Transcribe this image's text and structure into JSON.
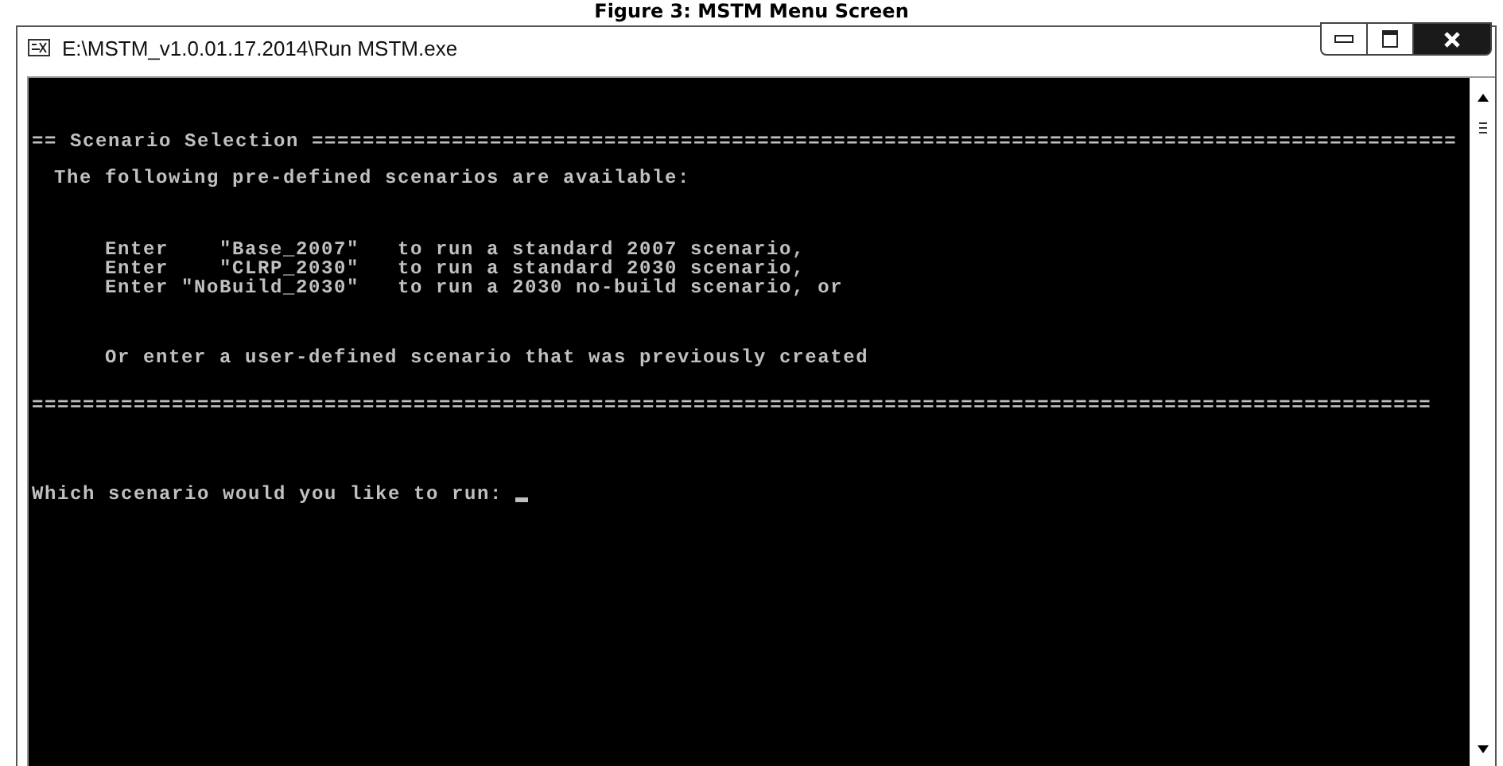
{
  "caption": "Figure 3: MSTM Menu Screen",
  "window": {
    "title": "E:\\MSTM_v1.0.01.17.2014\\Run MSTM.exe"
  },
  "console": {
    "lines": [
      {
        "kind": "heading",
        "text": "== Scenario Selection =========================================================================================="
      },
      {
        "kind": "text",
        "text": "The following pre-defined scenarios are available:"
      },
      {
        "kind": "option",
        "text": "Enter    \"Base_2007\"   to run a standard 2007 scenario,"
      },
      {
        "kind": "option",
        "text": "Enter    \"CLRP_2030\"   to run a standard 2030 scenario,"
      },
      {
        "kind": "option",
        "text": "Enter \"NoBuild_2030\"   to run a 2030 no-build scenario, or"
      },
      {
        "kind": "note",
        "text": "Or enter a user-defined scenario that was previously created"
      },
      {
        "kind": "rule",
        "text": "=============================================================================================================="
      },
      {
        "kind": "prompt",
        "text": "Which scenario would you like to run: "
      }
    ]
  }
}
